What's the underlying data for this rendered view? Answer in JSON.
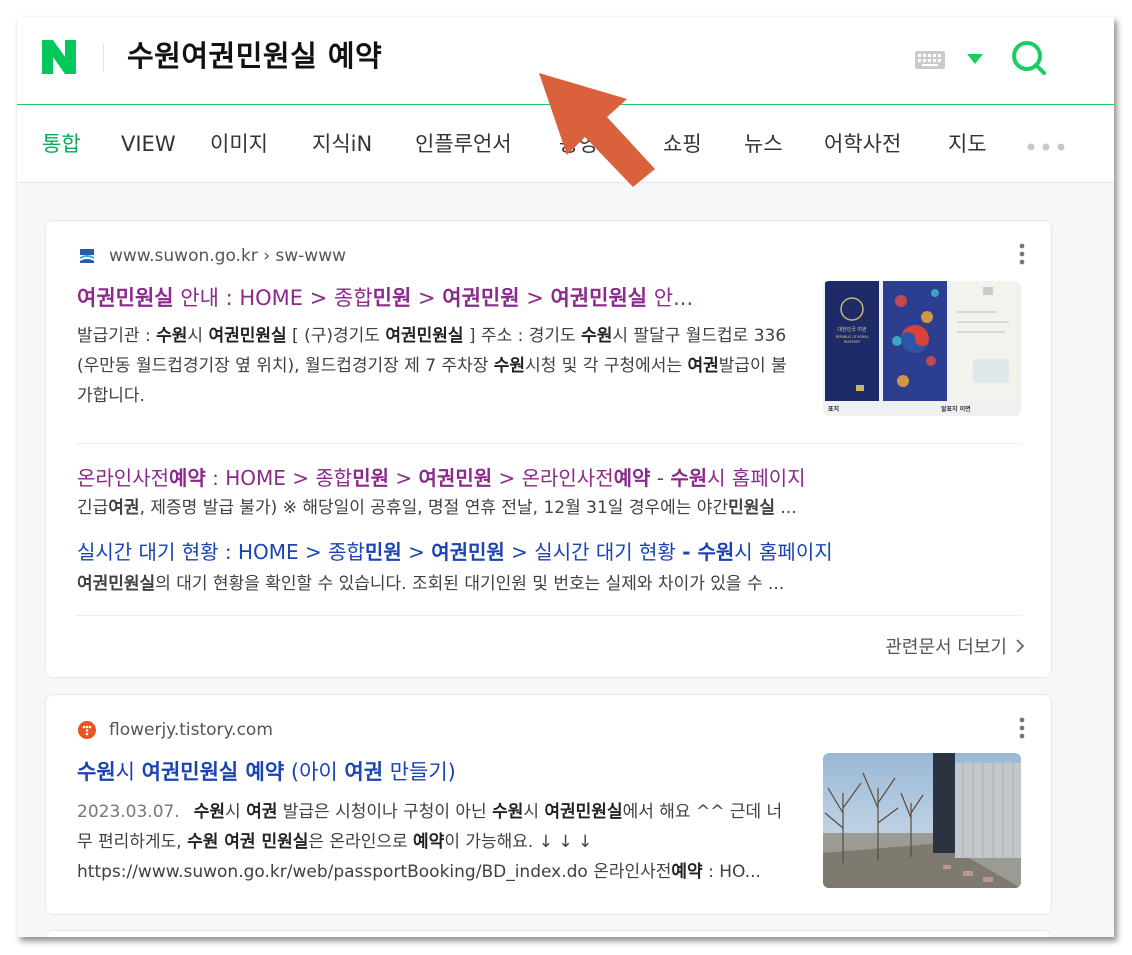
{
  "search": {
    "query": "수원여권민원실 예약"
  },
  "tabs": [
    {
      "label": "통합"
    },
    {
      "label": "VIEW"
    },
    {
      "label": "이미지"
    },
    {
      "label": "지식iN"
    },
    {
      "label": "인플루언서"
    },
    {
      "label": "동영상"
    },
    {
      "label": "쇼핑"
    },
    {
      "label": "뉴스"
    },
    {
      "label": "어학사전"
    },
    {
      "label": "지도"
    }
  ],
  "results": [
    {
      "site": "www.suwon.go.kr › sw-www",
      "title_parts": [
        "여권민원실",
        " 안내 : HOME > 종합",
        "민원",
        " > ",
        "여권민원",
        " > ",
        "여권민원실",
        " 안..."
      ],
      "desc_parts": [
        "발급기관 : ",
        "수원",
        "시 ",
        "여권민원실",
        " [ (구)경기도 ",
        "여권민원실",
        " ] 주소 : 경기도 ",
        "수원",
        "시 팔달구 월드컵로 336 (우만동 월드컵경기장 옆 위치), 월드컵경기장 제 7 주차장 ",
        "수원",
        "시청 및 각 구청에서는 ",
        "여권",
        "발급이 불가합니다."
      ],
      "thumb_labels": [
        "표지",
        "알표지 이면",
        "대한민국 여권",
        "REPUBLIC OF KOREA",
        "PASSPORT"
      ],
      "sub_links": [
        {
          "title_parts": [
            "온라인사전",
            "예약",
            " : HOME > 종합",
            "민원",
            " > ",
            "여권민원",
            " > 온라인사전",
            "예약",
            " - ",
            "수원",
            "시 홈페이지"
          ],
          "desc_parts": [
            "긴급",
            "여권",
            ", 제증명 발급 불가) ※ 해당일이 공휴일, 명절 연휴 전날, 12월 31일 경우에는 야간",
            "민원실",
            " ..."
          ]
        },
        {
          "title_parts": [
            "실시간 대기 현황 : HOME > 종합",
            "민원",
            " > ",
            "여권민원",
            " > 실시간 대기 현황 ",
            "- 수원",
            "시 홈페이지"
          ],
          "desc_parts": [
            "여권민원실",
            "의 대기 현황을 확인할 수 있습니다. 조회된 대기인원 및 번호는 실제와 차이가 있을 수 ..."
          ]
        }
      ],
      "more_label": "관련문서 더보기"
    },
    {
      "site": "flowerjy.tistory.com",
      "title_parts": [
        "수원",
        "시 ",
        "여권민원실 예약",
        " (아이 ",
        "여권",
        " 만들기)"
      ],
      "date": "2023.03.07.",
      "desc_parts": [
        "수원",
        "시 ",
        "여권",
        " 발급은 시청이나 구청이 아닌 ",
        "수원",
        "시 ",
        "여권민원실",
        "에서 해요 ^^ 근데 너무 편리하게도, ",
        "수원 여권 민원실",
        "은 온라인으로 ",
        "예약",
        "이 가능해요. ↓ ↓ ↓"
      ],
      "desc_line3_parts": [
        "https://www.suwon.go.kr/web/passportBooking/BD_index.do 온라인사전",
        "예약",
        " : HO..."
      ]
    }
  ],
  "colors": {
    "naver_green": "#03c75a",
    "active_tab": "#09aa5c",
    "visited_link": "#8a2a8a",
    "link": "#1a44b4",
    "annotation_arrow": "#d9623d"
  }
}
